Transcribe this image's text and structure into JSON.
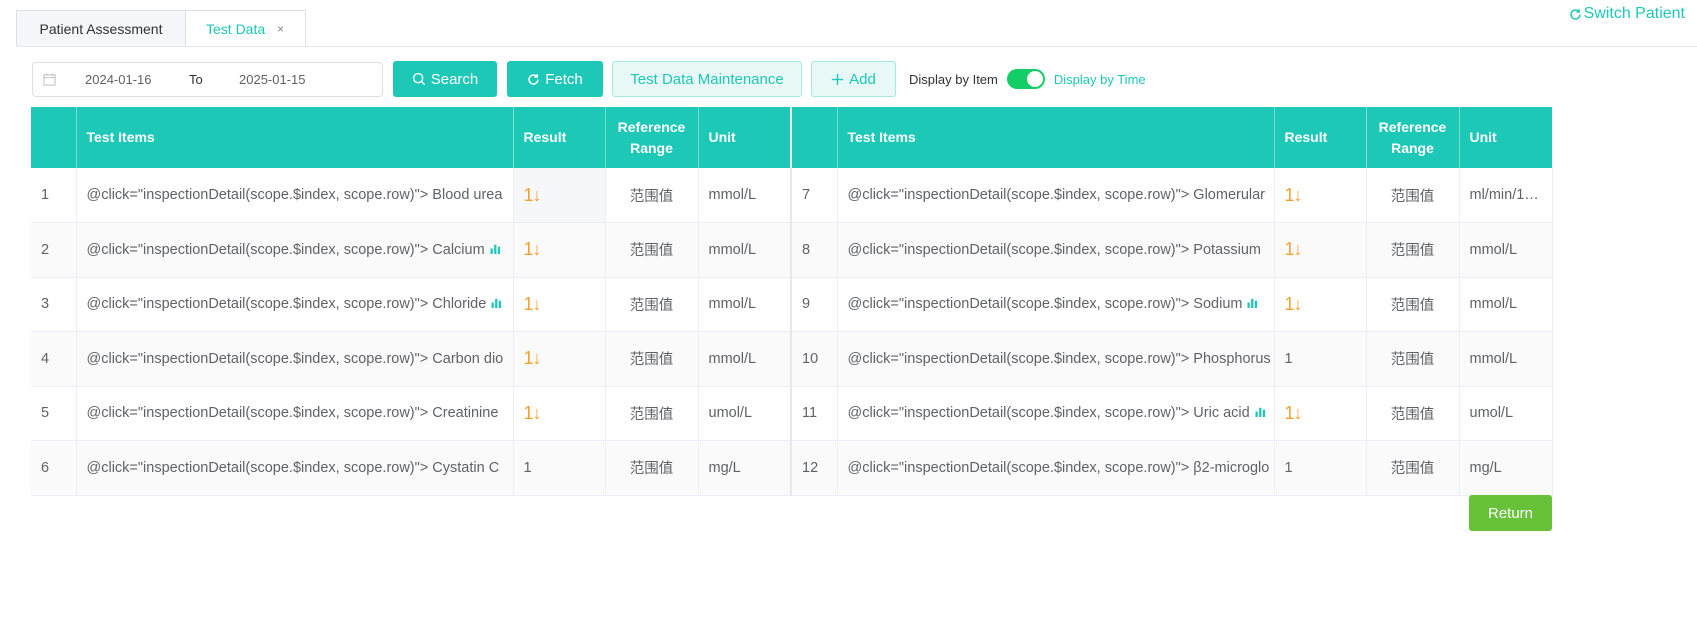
{
  "tabs": [
    {
      "label": "Patient Assessment"
    },
    {
      "label": "Test Data",
      "close": "×"
    }
  ],
  "header": {
    "switch_patient": "Switch Patient"
  },
  "toolbar": {
    "date_start": "2024-01-16",
    "date_sep": "To",
    "date_end": "2025-01-15",
    "search": "Search",
    "fetch": "Fetch",
    "maintenance": "Test Data Maintenance",
    "add": "Add",
    "display_by_item": "Display by Item",
    "display_by_time": "Display by Time"
  },
  "table": {
    "headers": {
      "items": "Test Items",
      "result": "Result",
      "ref_line1": "Reference",
      "ref_line2": "Range",
      "unit": "Unit"
    },
    "prefix": "@click=\"inspectionDetail(scope.$index, scope.row)\">",
    "rows": [
      {
        "left": {
          "idx": "1",
          "name": "Blood urea",
          "result": "1↓",
          "ref": "范围值",
          "unit": "mmol/L",
          "icon": false
        },
        "right": {
          "idx": "7",
          "name": "Glomerular",
          "result": "1↓",
          "ref": "范围值",
          "unit": "ml/min/1…",
          "icon": false
        }
      },
      {
        "left": {
          "idx": "2",
          "name": "Calcium",
          "result": "1↓",
          "ref": "范围值",
          "unit": "mmol/L",
          "icon": true
        },
        "right": {
          "idx": "8",
          "name": "Potassium",
          "result": "1↓",
          "ref": "范围值",
          "unit": "mmol/L",
          "icon": false
        }
      },
      {
        "left": {
          "idx": "3",
          "name": "Chloride",
          "result": "1↓",
          "ref": "范围值",
          "unit": "mmol/L",
          "icon": true
        },
        "right": {
          "idx": "9",
          "name": "Sodium",
          "result": "1↓",
          "ref": "范围值",
          "unit": "mmol/L",
          "icon": true
        }
      },
      {
        "left": {
          "idx": "4",
          "name": "Carbon dio",
          "result": "1↓",
          "ref": "范围值",
          "unit": "mmol/L",
          "icon": false
        },
        "right": {
          "idx": "10",
          "name": "Phosphorus",
          "result": "1",
          "ref": "范围值",
          "unit": "mmol/L",
          "icon": false
        }
      },
      {
        "left": {
          "idx": "5",
          "name": "Creatinine",
          "result": "1↓",
          "ref": "范围值",
          "unit": "umol/L",
          "icon": false
        },
        "right": {
          "idx": "11",
          "name": "Uric acid",
          "result": "1↓",
          "ref": "范围值",
          "unit": "umol/L",
          "icon": true
        }
      },
      {
        "left": {
          "idx": "6",
          "name": "Cystatin C",
          "result": "1",
          "ref": "范围值",
          "unit": "mg/L",
          "icon": false
        },
        "right": {
          "idx": "12",
          "name": "β2-microglo",
          "result": "1",
          "ref": "范围值",
          "unit": "mg/L",
          "icon": false
        }
      }
    ]
  },
  "footer": {
    "return": "Return"
  },
  "icons": {
    "refresh": "refresh-icon",
    "calendar": "calendar-icon",
    "search": "search-icon",
    "plus": "plus-icon",
    "chart": "bar-chart-icon"
  },
  "colors": {
    "accent": "#1ec8b7",
    "arrow": "#f5a031",
    "return": "#67c23a",
    "switch_on": "#13ce66"
  }
}
